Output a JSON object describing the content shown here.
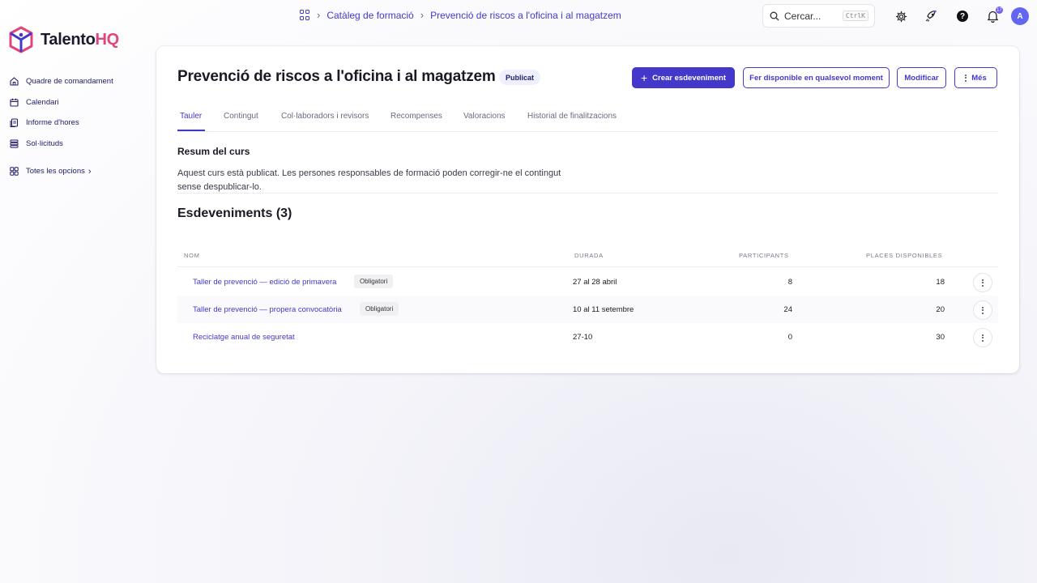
{
  "app": {
    "logo_main": "Talento",
    "logo_accent": "HQ"
  },
  "breadcrumb": {
    "items": [
      "Catàleg de formació",
      "Prevenció de riscos a l'oficina i al magatzem"
    ]
  },
  "search": {
    "label": "Cercar...",
    "shortcut": "CtrlK"
  },
  "header_icons": [
    "gear-icon",
    "rocket-icon",
    "help-icon",
    "bell-icon"
  ],
  "help_label": "?",
  "notifications": {
    "count": "17"
  },
  "user": {
    "initial": "A"
  },
  "sidebar": {
    "items": [
      {
        "label": "Quadre de comandament",
        "icon": "home-icon"
      },
      {
        "label": "Calendari",
        "icon": "calendar-icon"
      },
      {
        "label": "Informe d'hores",
        "icon": "report-icon"
      },
      {
        "label": "Sol·licituds",
        "icon": "list-icon"
      }
    ],
    "all_options": "Totes les opcions"
  },
  "course": {
    "title": "Prevenció de riscos a l'oficina i al magatzem",
    "status": "Publicat",
    "actions": {
      "create_event": "Crear esdeveniment",
      "make_available": "Fer disponible en qualsevol moment",
      "edit": "Modificar",
      "more": "Més"
    },
    "tabs": [
      "Tauler",
      "Contingut",
      "Col·laboradors i revisors",
      "Recompenses",
      "Valoracions",
      "Historial de finalitzacions"
    ],
    "active_tab": "Tauler",
    "summary_title": "Resum del curs",
    "summary_text": "Aquest curs està publicat. Les persones responsables de formació poden corregir-ne el contingut sense despublicar-lo.",
    "events_title": "Esdeveniments (3)"
  },
  "events_table": {
    "headers": [
      "NOM",
      "DURADA",
      "PARTICIPANTS",
      "PLACES DISPONIBLES"
    ],
    "rows": [
      {
        "name": "Taller de prevenció — edició de primavera",
        "tag": "Obligatori",
        "duration": "27 al 28 abril",
        "participants": "8",
        "places": "18"
      },
      {
        "name": "Taller de prevenció — propera convocatòria",
        "tag": "Obligatori",
        "duration": "10 al 11 setembre",
        "participants": "24",
        "places": "20"
      },
      {
        "name": "Reciclatge anual de seguretat",
        "tag": "",
        "duration": "27-10",
        "participants": "0",
        "places": "30"
      }
    ]
  },
  "colors": {
    "accent": "#4338ca",
    "brand_pink": "#e0457b",
    "avatar": "#6366f1"
  }
}
